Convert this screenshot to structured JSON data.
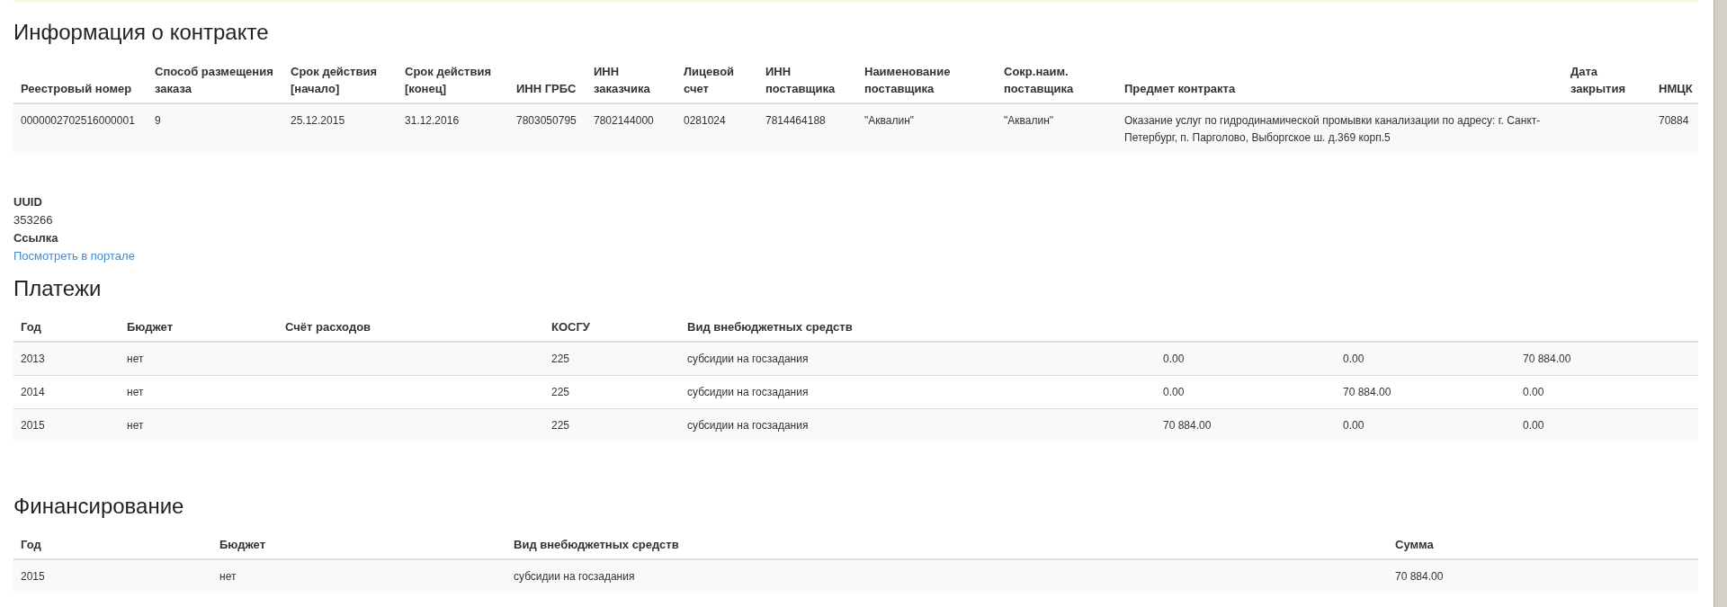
{
  "contract": {
    "title": "Информация о контракте",
    "columns": [
      "Реестровый номер",
      "Способ размещения заказа",
      "Срок действия [начало]",
      "Срок действия [конец]",
      "ИНН ГРБС",
      "ИНН заказчика",
      "Лицевой счет",
      "ИНН поставщика",
      "Наименование поставщика",
      "Сокр.наим. поставщика",
      "Предмет контракта",
      "Дата закрытия",
      "НМЦК"
    ],
    "rows": [
      [
        "0000002702516000001",
        "9",
        "25.12.2015",
        "31.12.2016",
        "7803050795",
        "7802144000",
        "0281024",
        "7814464188",
        "\"Аквалин\"",
        "\"Аквалин\"",
        "Оказание услуг по гидродинамической промывки канализации по адресу: г. Санкт-Петербург, п. Парголово, Выборгское ш. д.369 корп.5",
        "",
        "70884"
      ]
    ]
  },
  "details": [
    {
      "label": "UUID",
      "value": "353266",
      "kind": "text"
    },
    {
      "label": "Ссылка",
      "value": "Посмотреть в портале",
      "kind": "link"
    }
  ],
  "payments": {
    "title": "Платежи",
    "columns": [
      "Год",
      "Бюджет",
      "Счёт расходов",
      "КОСГУ",
      "Вид внебюджетных средств",
      "",
      "",
      ""
    ],
    "rows": [
      [
        "2013",
        "нет",
        "",
        "225",
        "субсидии на госзадания",
        "0.00",
        "0.00",
        "70 884.00"
      ],
      [
        "2014",
        "нет",
        "",
        "225",
        "субсидии на госзадания",
        "0.00",
        "70 884.00",
        "0.00"
      ],
      [
        "2015",
        "нет",
        "",
        "225",
        "субсидии на госзадания",
        "70 884.00",
        "0.00",
        "0.00"
      ]
    ]
  },
  "financing": {
    "title": "Финансирование",
    "columns": [
      "Год",
      "Бюджет",
      "Вид внебюджетных средств",
      "Сумма"
    ],
    "rows": [
      [
        "2015",
        "нет",
        "субсидии на госзадания",
        "70 884.00"
      ]
    ]
  }
}
